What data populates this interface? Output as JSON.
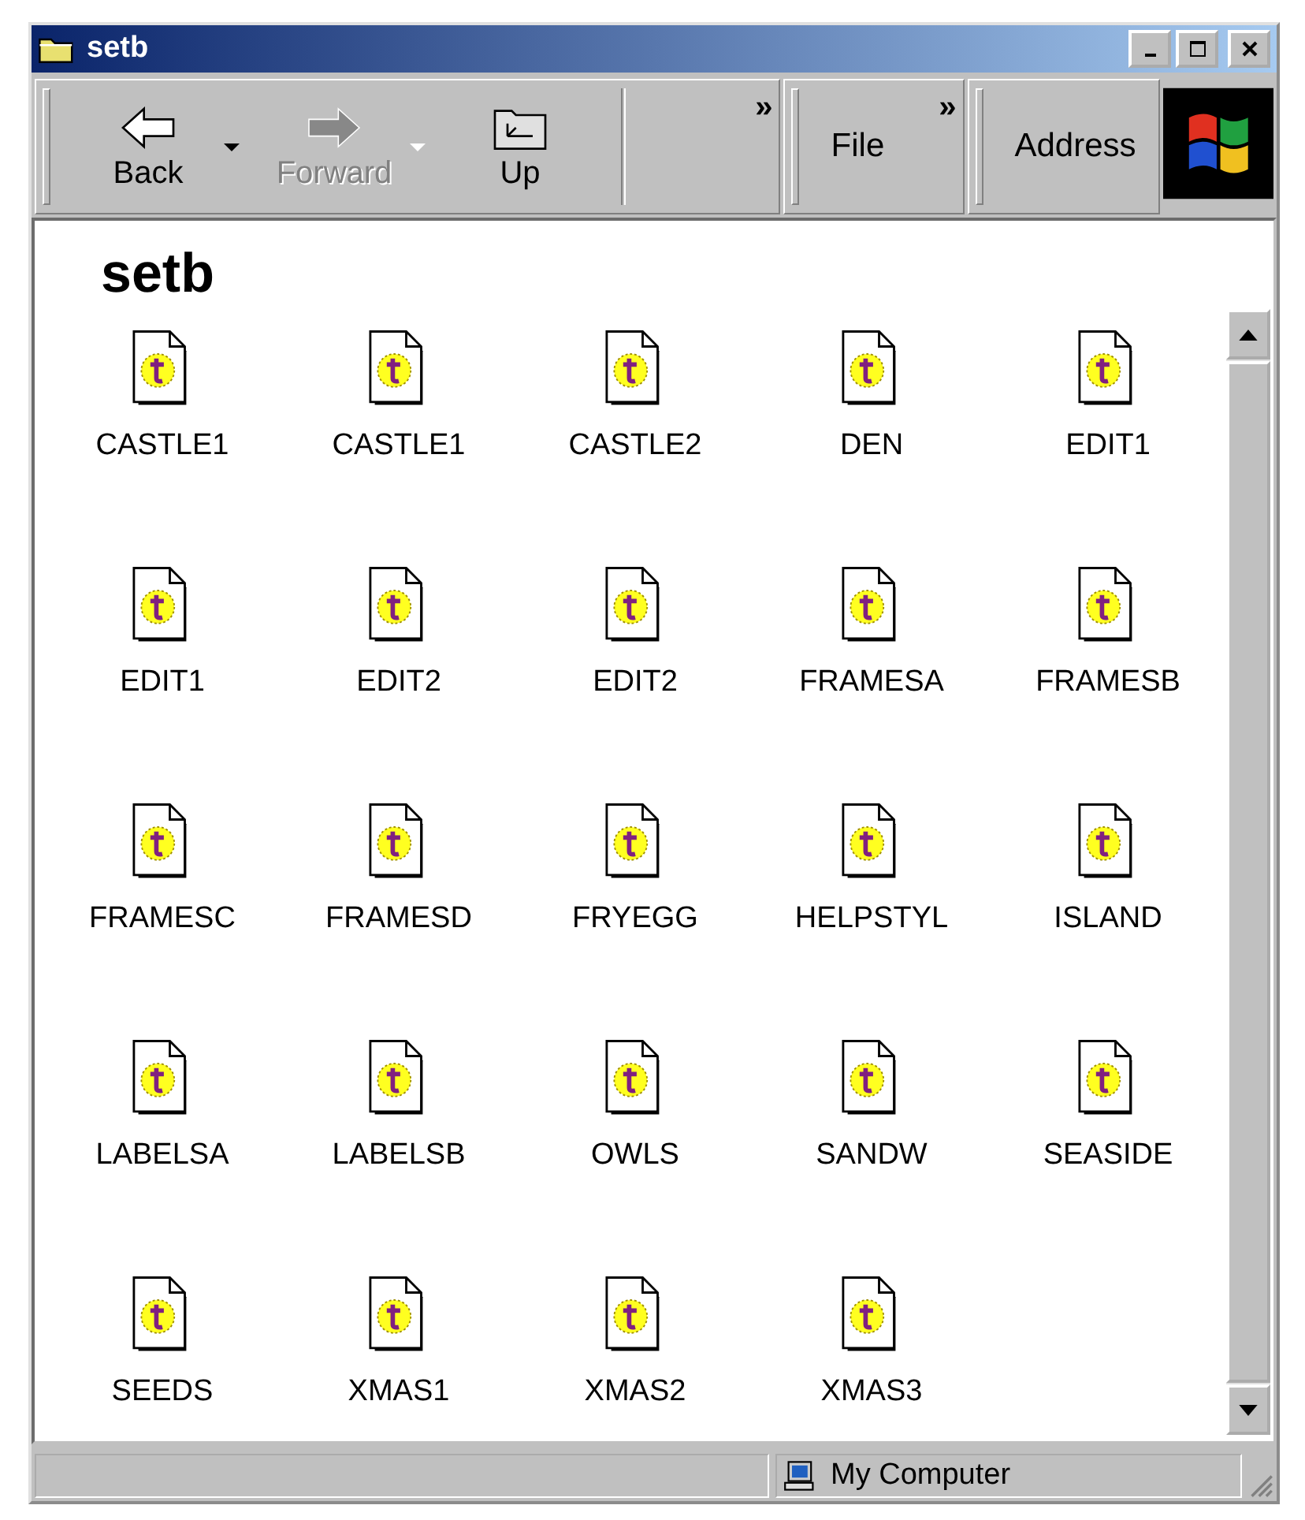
{
  "window": {
    "title": "setb"
  },
  "toolbar": {
    "buttons": [
      {
        "kind": "back",
        "label": "Back",
        "disabled": false,
        "dropdown": true
      },
      {
        "kind": "forward",
        "label": "Forward",
        "disabled": true,
        "dropdown": true
      },
      {
        "kind": "up",
        "label": "Up",
        "disabled": false,
        "dropdown": false
      }
    ],
    "chevrons": [
      "»",
      "»"
    ],
    "menu": "File",
    "address": "Address"
  },
  "folder_title": "setb",
  "files": [
    {
      "name": "CASTLE1"
    },
    {
      "name": "CASTLE1"
    },
    {
      "name": "CASTLE2"
    },
    {
      "name": "DEN"
    },
    {
      "name": "EDIT1"
    },
    {
      "name": "EDIT1"
    },
    {
      "name": "EDIT2"
    },
    {
      "name": "EDIT2"
    },
    {
      "name": "FRAMESA"
    },
    {
      "name": "FRAMESB"
    },
    {
      "name": "FRAMESC"
    },
    {
      "name": "FRAMESD"
    },
    {
      "name": "FRYEGG"
    },
    {
      "name": "HELPSTYL"
    },
    {
      "name": "ISLAND"
    },
    {
      "name": "LABELSA"
    },
    {
      "name": "LABELSB"
    },
    {
      "name": "OWLS"
    },
    {
      "name": "SANDW"
    },
    {
      "name": "SEASIDE"
    },
    {
      "name": "SEEDS"
    },
    {
      "name": "XMAS1"
    },
    {
      "name": "XMAS2"
    },
    {
      "name": "XMAS3"
    }
  ],
  "status_bar": {
    "zone": "My Computer"
  }
}
